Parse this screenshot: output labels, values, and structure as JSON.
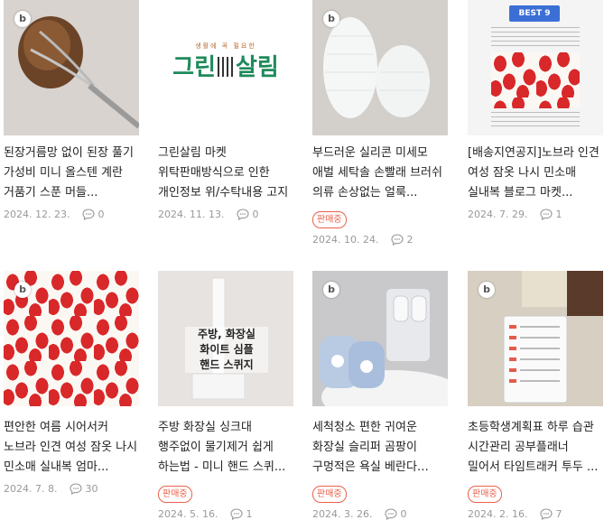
{
  "blog_badge": "b",
  "items": [
    {
      "title": "된장거름망 없이 된장 풀기 가성비 미니 올스텐 계란 거품기 스푼 머들...",
      "tag": "",
      "date": "2024. 12. 23.",
      "comments": "0"
    },
    {
      "title": "그린살림 마켓 위탁판매방식으로 인한 개인정보 위/수탁내용 고지",
      "tag": "",
      "date": "2024. 11. 13.",
      "comments": "0",
      "logo": {
        "tagline": "생활에 꼭 필요한",
        "left": "그린",
        "right": "살림",
        "color": "#1f8a5b"
      }
    },
    {
      "title": "부드러운 실리콘 미세모 애벌 세탁솔 손빨래 브러쉬 의류 손상없는 얼룩...",
      "tag": "판매중",
      "date": "2024. 10. 24.",
      "comments": "2"
    },
    {
      "title": "[배송지연공지]노브라 인견 여성 잠옷 나시 민소매 실내복 블로그 마켓...",
      "tag": "",
      "date": "2024. 7. 29.",
      "comments": "1",
      "best_label": "BEST 9"
    },
    {
      "title": "편안한 여름 시어서커 노브라 인견 여성 잠옷 나시 민소매 실내복 엄마...",
      "tag": "",
      "date": "2024. 7. 8.",
      "comments": "30"
    },
    {
      "title": "주방 화장실 싱크대 행주없이 물기제거 쉽게 하는법 - 미니 핸드 스퀴...",
      "tag": "판매중",
      "date": "2024. 5. 16.",
      "comments": "1",
      "overlay": [
        "주방, 화장실",
        "화이트 심플",
        "핸드 스퀴지"
      ]
    },
    {
      "title": "세척청소 편한 귀여운 화장실 슬리퍼 곰팡이 구멍적은 욕실 베란다 실내화...",
      "tag": "판매중",
      "date": "2024. 3. 26.",
      "comments": "0"
    },
    {
      "title": "초등학생계획표 하루 습관 시간관리 공부플래너 밀어서 타임트래커 투두 ...",
      "tag": "판매중",
      "date": "2024. 2. 16.",
      "comments": "7"
    }
  ],
  "colors": {
    "accent": "#e9614b",
    "meta": "#999999",
    "logo_green": "#1f8a5b"
  }
}
